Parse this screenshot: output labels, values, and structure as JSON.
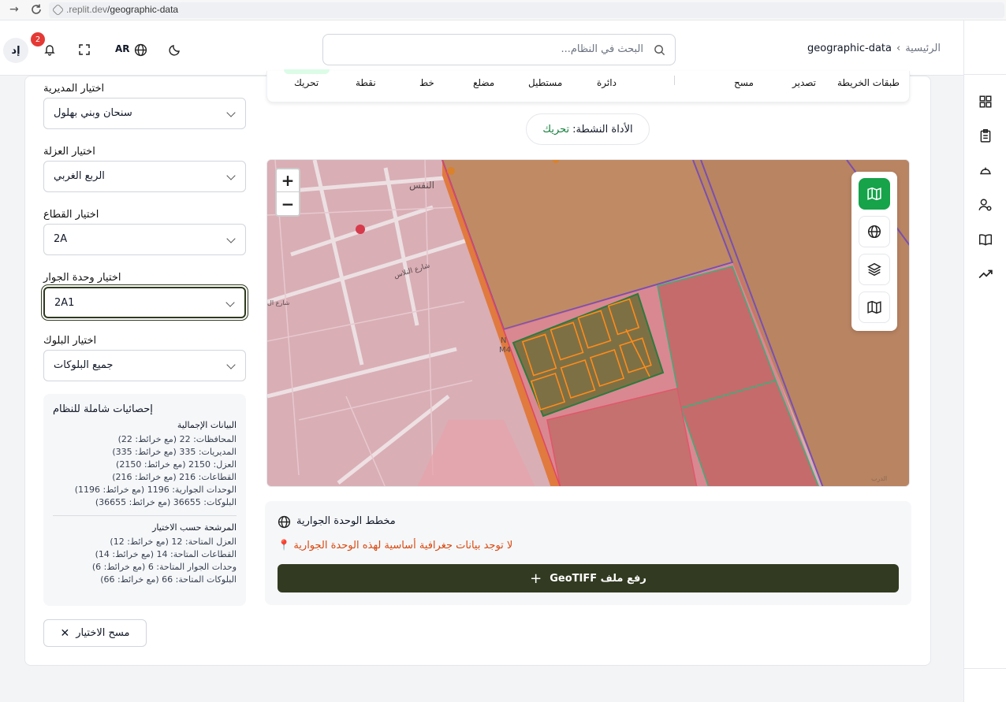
{
  "browser": {
    "url_dim": ".replit.dev",
    "url_path": "/geographic-data"
  },
  "header": {
    "avatar": "إد",
    "notifications_count": "2",
    "lang": "AR",
    "search_placeholder": "البحث في النظام...",
    "breadcrumb_home": "الرئيسية",
    "breadcrumb_current": "geographic-data"
  },
  "filters": {
    "directorate_label": "اختيار المديرية",
    "directorate_value": "سنحان وبني بهلول",
    "uzla_label": "اختيار العزلة",
    "uzla_value": "الربع الغربي",
    "sector_label": "اختيار القطاع",
    "sector_value": "2A",
    "neighborhood_label": "اختيار وحدة الجوار",
    "neighborhood_value": "2A1",
    "block_label": "اختيار البلوك",
    "block_value": "جميع البلوكات"
  },
  "stats": {
    "title": "إحصائيات شاملة للنظام",
    "totals_title": "البيانات الإجمالية",
    "totals": [
      "المحافظات: 22 (مع خرائط: 22)",
      "المديريات: 335 (مع خرائط: 335)",
      "العزل: 2150 (مع خرائط: 2150)",
      "القطاعات: 216 (مع خرائط: 216)",
      "الوحدات الجوارية: 1196 (مع خرائط: 1196)",
      "البلوكات: 36655 (مع خرائط: 36655)"
    ],
    "filtered_title": "المرشحة حسب الاختيار",
    "filtered": [
      "العزل المتاحة: 12 (مع خرائط: 12)",
      "القطاعات المتاحة: 14 (مع خرائط: 14)",
      "وحدات الجوار المتاحة: 6 (مع خرائط: 6)",
      "البلوكات المتاحة: 66 (مع خرائط: 66)"
    ]
  },
  "clear_button": "مسح الاختيار",
  "toolbar": {
    "layers": "طبقات الخريطة",
    "export": "تصدير",
    "clear": "مسح",
    "circle": "دائرة",
    "rectangle": "مستطيل",
    "polygon": "مضلع",
    "line": "خط",
    "point": "نقطة",
    "move": "تحريك"
  },
  "active_tool": {
    "label": "الأداة النشطة:",
    "value": "تحريك"
  },
  "map": {
    "zoom_in": "+",
    "zoom_out": "−",
    "labels": [
      "النفس",
      "شارع النلاس",
      "شارع ال",
      "الدرب",
      "N",
      "M4"
    ]
  },
  "plan": {
    "title": "مخطط الوحدة الجوارية",
    "warning": "لا توجد بيانات جغرافية أساسية لهذه الوحدة الجوارية",
    "upload": "رفع ملف GeoTIFF"
  },
  "colors": {
    "accent": "#16a34a",
    "dark_button": "#323a21",
    "warning": "#d9480f",
    "badge": "#e53935"
  }
}
